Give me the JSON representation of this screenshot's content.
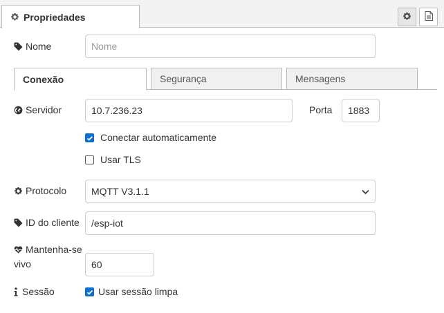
{
  "header": {
    "tab_label": "Propriedades",
    "settings_icon": "gear-icon",
    "doc_icon": "document-icon"
  },
  "form": {
    "name": {
      "label": "Nome",
      "placeholder": "Nome",
      "value": ""
    },
    "tabs": [
      {
        "label": "Conexão",
        "active": true
      },
      {
        "label": "Segurança",
        "active": false
      },
      {
        "label": "Mensagens",
        "active": false
      }
    ],
    "server": {
      "label": "Servidor",
      "value": "10.7.236.23"
    },
    "port": {
      "label": "Porta",
      "value": "1883"
    },
    "auto_connect": {
      "label": "Conectar automaticamente",
      "checked": true
    },
    "use_tls": {
      "label": "Usar TLS",
      "checked": false
    },
    "protocol": {
      "label": "Protocolo",
      "value": "MQTT V3.1.1"
    },
    "client_id": {
      "label": "ID do cliente",
      "value": "/esp-iot"
    },
    "keepalive": {
      "label_line1": "Mantenha-se",
      "label_line2": "vivo",
      "value": "60"
    },
    "session": {
      "label": "Sessão",
      "checkbox_label": "Usar sessão limpa",
      "checked": true
    }
  },
  "colors": {
    "accent": "#0b6fd1",
    "border": "#bbbbbb"
  }
}
